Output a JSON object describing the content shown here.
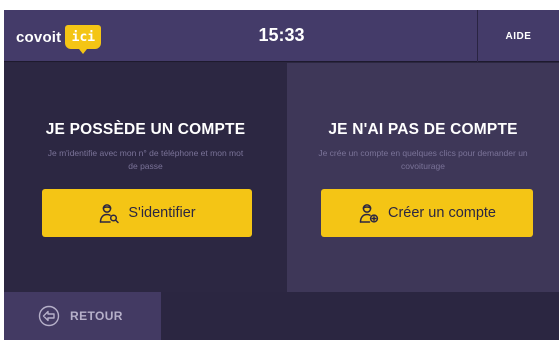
{
  "header": {
    "logo_text": "covoit",
    "logo_badge": "ici",
    "clock": "15:33",
    "help_label": "AIDE"
  },
  "left_panel": {
    "title": "JE POSSÈDE UN COMPTE",
    "subtitle": "Je m'identifie avec mon n° de téléphone et mon mot de passe",
    "button_label": "S'identifier",
    "button_icon": "user-search-icon"
  },
  "right_panel": {
    "title": "JE N'AI PAS DE COMPTE",
    "subtitle": "Je crée un compte en quelques clics pour demander un covoiturage",
    "button_label": "Créer un compte",
    "button_icon": "user-add-icon"
  },
  "footer": {
    "back_label": "RETOUR",
    "back_icon": "back-arrow-icon"
  },
  "colors": {
    "accent": "#f4c515",
    "header_bg": "#443b69",
    "panel_dark": "#2c2742",
    "panel_light": "#3e3758"
  }
}
